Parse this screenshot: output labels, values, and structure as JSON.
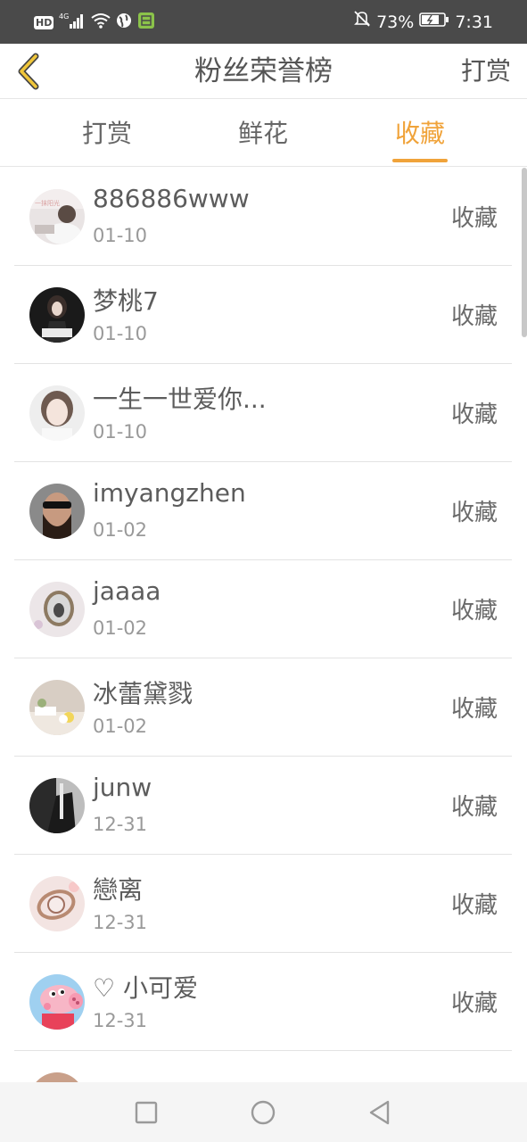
{
  "status_bar": {
    "left_label": "HD",
    "network": "4G",
    "battery_percent": "73%",
    "time": "7:31"
  },
  "header": {
    "title": "粉丝荣誉榜",
    "action_label": "打赏"
  },
  "tabs": [
    {
      "label": "打赏",
      "active": false
    },
    {
      "label": "鲜花",
      "active": false
    },
    {
      "label": "收藏",
      "active": true
    }
  ],
  "colors": {
    "accent": "#f0a33a",
    "status_bar": "#4a4a4a"
  },
  "list": [
    {
      "name": "886886www",
      "date": "01-10",
      "action": "收藏",
      "avatar": "photo-girl-window"
    },
    {
      "name": "梦桃7",
      "date": "01-10",
      "action": "收藏",
      "avatar": "photo-dark-girl"
    },
    {
      "name": "一生一世爱你...",
      "date": "01-10",
      "action": "收藏",
      "avatar": "photo-girl-face"
    },
    {
      "name": "imyangzhen",
      "date": "01-02",
      "action": "收藏",
      "avatar": "photo-bearded-man"
    },
    {
      "name": "jaaaa",
      "date": "01-02",
      "action": "收藏",
      "avatar": "photo-pendant"
    },
    {
      "name": "冰蕾黛戮",
      "date": "01-02",
      "action": "收藏",
      "avatar": "photo-room-flowers"
    },
    {
      "name": "junw",
      "date": "12-31",
      "action": "收藏",
      "avatar": "photo-dark-portrait"
    },
    {
      "name": "戀离",
      "date": "12-31",
      "action": "收藏",
      "avatar": "photo-pink-watch"
    },
    {
      "name": "♡ 小可爱",
      "date": "12-31",
      "action": "收藏",
      "avatar": "peppa-pig"
    }
  ]
}
